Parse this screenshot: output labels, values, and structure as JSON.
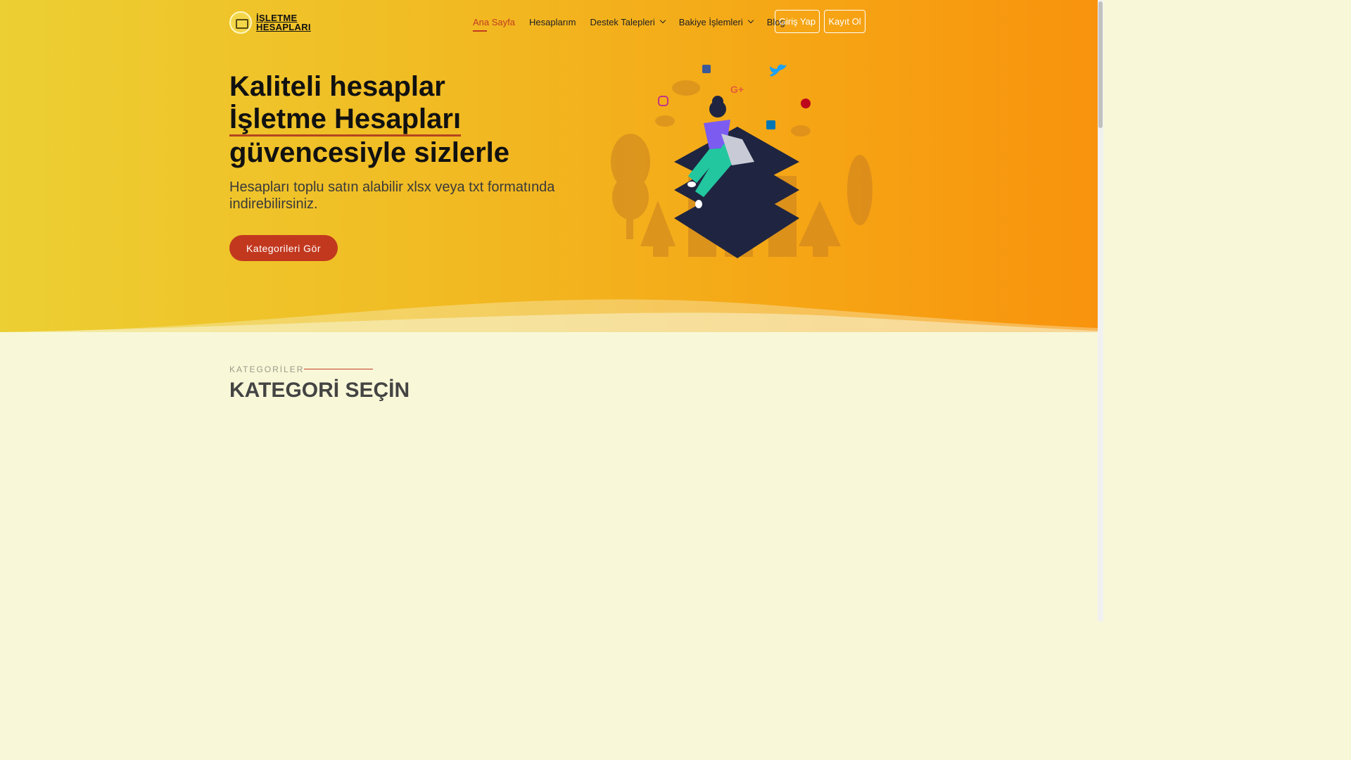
{
  "brand": {
    "name_line1": "İŞLETME",
    "name_line2": "HESAPLARI"
  },
  "nav": {
    "items": [
      {
        "label": "Ana Sayfa"
      },
      {
        "label": "Hesaplarım"
      },
      {
        "label": "Destek Talepleri"
      },
      {
        "label": "Bakiye İşlemleri"
      },
      {
        "label": "Blog"
      }
    ],
    "login": "Giriş Yap",
    "register": "Kayıt Ol"
  },
  "hero": {
    "line1": "Kaliteli hesaplar",
    "line2": "İşletme Hesapları",
    "line3": "güvencesiyle sizlerle",
    "subtitle": "Hesapları toplu satın alabilir xlsx veya txt formatında indirebilirsiniz.",
    "cta": "Kategorileri Gör"
  },
  "section": {
    "label": "KATEGORİLER",
    "title": "KATEGORİ SEÇİN"
  },
  "colors": {
    "accent": "#c2381f",
    "hero_start": "#eccf33",
    "hero_end": "#f8930d",
    "page_bg": "#f8f8d9"
  }
}
